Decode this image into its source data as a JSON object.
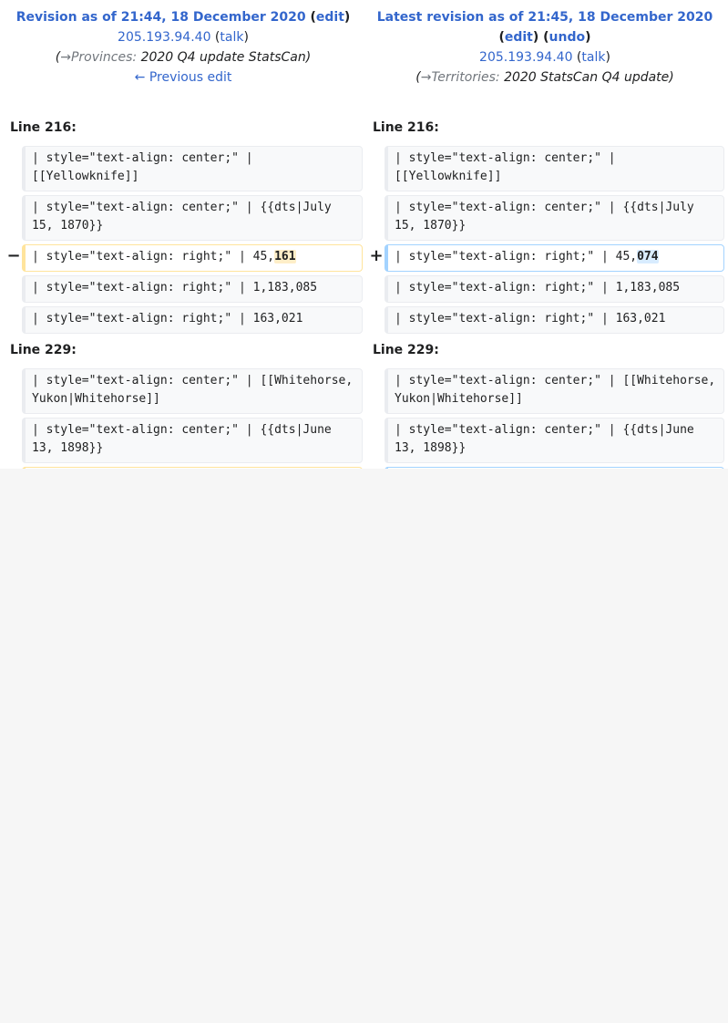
{
  "left_header": {
    "title_prefix": "Revision as of 21:44, 18 December 2020",
    "edit_label": "edit",
    "user": "205.193.94.40",
    "talk_label": "talk",
    "summary_arrow": "→Provinces:",
    "summary_text": "2020 Q4 update StatsCan",
    "prev_edit_label": "← Previous edit"
  },
  "right_header": {
    "title_prefix": "Latest revision as of 21:45, 18 December 2020",
    "edit_label": "edit",
    "undo_label": "undo",
    "user": "205.193.94.40",
    "talk_label": "talk",
    "summary_arrow": "→Territories:",
    "summary_text": "2020 StatsCan Q4 update"
  },
  "block1": {
    "line_label": "Line 216:",
    "rows": [
      "| style=\"text-align: center;\" | [[Yellowknife]]",
      "| style=\"text-align: center;\" | {{dts|July 15, 1870}}",
      "",
      "| style=\"text-align: right;\" | 1,183,085",
      "| style=\"text-align: right;\" | 163,021"
    ],
    "changed_prefix": "| style=\"text-align: right;\" | 45,",
    "deleted_word": "161",
    "added_word": "074",
    "minus": "−",
    "plus": "+"
  },
  "block2": {
    "line_label": "Line 229:",
    "rows": [
      "| style=\"text-align: center;\" | [[Whitehorse, Yukon|Whitehorse]]",
      "| style=\"text-align: center;\" | {{dts|June 13, 1898}}"
    ]
  }
}
